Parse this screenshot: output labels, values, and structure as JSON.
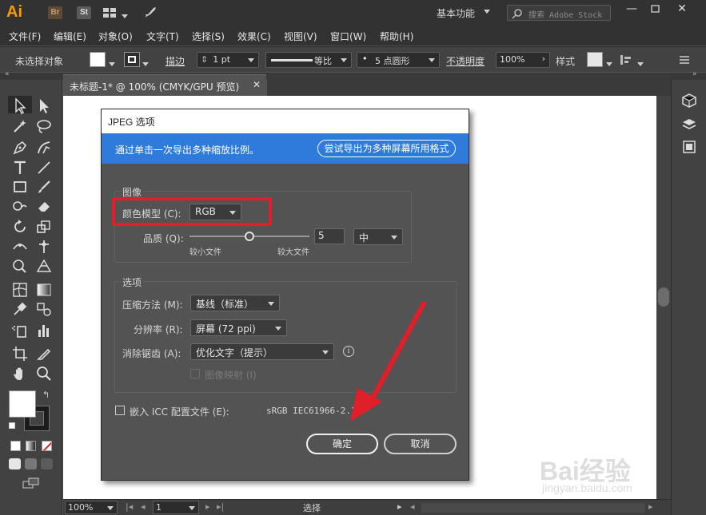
{
  "app": {
    "logo": "Ai",
    "bridge": "Br",
    "stock": "St",
    "workspace": "基本功能",
    "search_placeholder": "搜索 Adobe Stock",
    "colors": {
      "brand": "#ff9a00",
      "accent": "#2e7bdc",
      "annotation": "#e01f2b"
    }
  },
  "menu": [
    "文件(F)",
    "编辑(E)",
    "对象(O)",
    "文字(T)",
    "选择(S)",
    "效果(C)",
    "视图(V)",
    "窗口(W)",
    "帮助(H)"
  ],
  "control": {
    "no_selection": "未选择对象",
    "stroke_label": "描边",
    "stroke_value": "1 pt",
    "stroke_style": "等比",
    "brush": "5 点圆形",
    "opacity_label": "不透明度",
    "opacity_value": "100%",
    "style_label": "样式"
  },
  "document": {
    "tab_title": "未标题-1* @ 100% (CMYK/GPU 预览)",
    "close": "✕"
  },
  "status": {
    "zoom": "100%",
    "page": "1",
    "tool": "选择"
  },
  "dialog": {
    "title": "JPEG 选项",
    "banner_text": "通过单击一次导出多种缩放比例。",
    "banner_button": "尝试导出为多种屏幕所用格式",
    "image_group": "图像",
    "color_model_label": "颜色模型 (C):",
    "color_model_value": "RGB",
    "quality_label": "品质 (Q):",
    "quality_value": "5",
    "quality_level": "中",
    "quality_fraction": 0.5,
    "smaller_file": "较小文件",
    "larger_file": "较大文件",
    "options_group": "选项",
    "compression_label": "压缩方法 (M):",
    "compression_value": "基线（标准）",
    "resolution_label": "分辨率 (R):",
    "resolution_value": "屏幕 (72 ppi)",
    "antialias_label": "消除锯齿 (A):",
    "antialias_value": "优化文字（提示）",
    "imagemap_label": "图像映射 (I)",
    "embed_icc_label": "嵌入 ICC 配置文件 (E):",
    "embed_icc_value": "sRGB IEC61966-2.1",
    "ok": "确定",
    "cancel": "取消"
  },
  "watermark": {
    "brand": "Bai经验",
    "url": "jingyan.baidu.com"
  }
}
